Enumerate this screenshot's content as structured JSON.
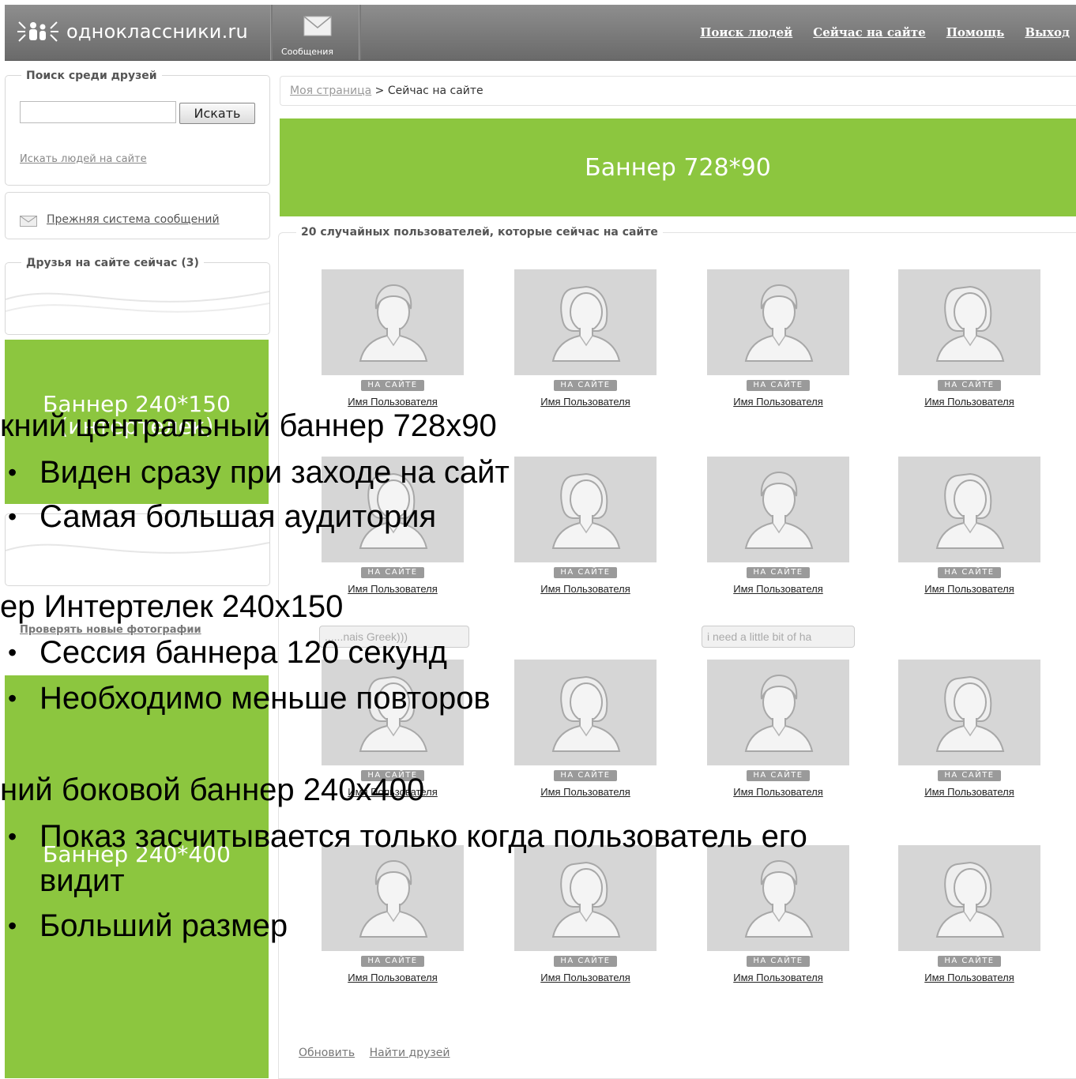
{
  "header": {
    "logo_text": "одноклассники.ru",
    "messages_label": "Сообщения",
    "nav": [
      "Поиск людей",
      "Сейчас на сайте",
      "Помощь",
      "Выход"
    ]
  },
  "sidebar": {
    "search_title": "Поиск среди друзей",
    "search_value": "",
    "search_button": "Искать",
    "search_people_link": "Искать людей на сайте",
    "old_messages_link": "Прежняя система сообщений",
    "friends_online_title": "Друзья на сайте сейчас (3)",
    "check_photos_link": "Проверять новые фотографии",
    "banner_small": [
      "Баннер 240*150",
      "(интертелек)"
    ],
    "banner_large": "Баннер 240*400"
  },
  "breadcrumb": {
    "link": "Моя страница",
    "separator": ">",
    "current": "Сейчас на сайте"
  },
  "banner_top": "Баннер 728*90",
  "users": {
    "heading": "20 случайных пользователей, которые сейчас на сайте",
    "online_badge": "НА САЙТЕ",
    "user_name": "Имя Пользователя",
    "speech_bubbles": [
      "......nais Greek)))",
      "i need a little bit of ha"
    ]
  },
  "footer": {
    "refresh": "Обновить",
    "find_friends": "Найти друзей"
  },
  "overlay": {
    "line1": "кний центральный баннер 728х90",
    "b1": "Виден сразу при заходе на сайт",
    "b2": "Самая большая аудитория",
    "line2": "ер Интертелек 240х150",
    "b3": "Сессия баннера 120 секунд",
    "b4": "Необходимо меньше повторов",
    "line3": "ний боковой баннер 240х400",
    "b5a": "Показ засчитывается только когда пользователь его",
    "b5b": "видит",
    "b6": "Больший размер"
  },
  "colors": {
    "banner_green": "#8cc63f",
    "header_gray": "#7d7d7d",
    "avatar_gray": "#d6d6d6"
  }
}
